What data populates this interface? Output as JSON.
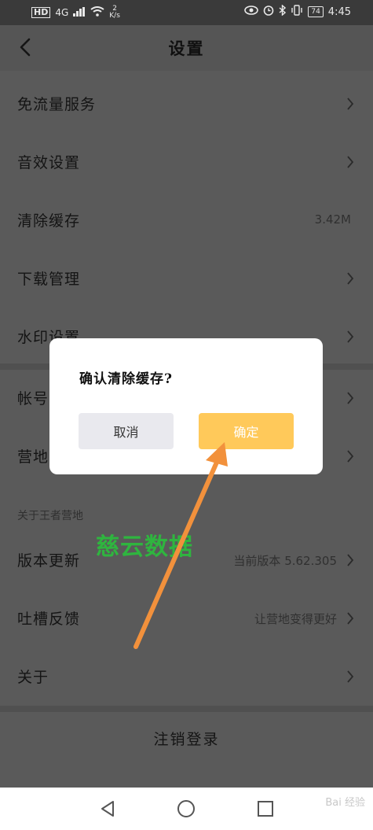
{
  "status_bar": {
    "hd": "HD",
    "network": "4G",
    "speed_value": "2",
    "speed_unit": "K/s",
    "battery": "74",
    "time": "4:45"
  },
  "nav": {
    "title": "设置"
  },
  "settings": {
    "items": [
      {
        "label": "免流量服务"
      },
      {
        "label": "音效设置"
      },
      {
        "label": "清除缓存",
        "value": "3.42M"
      },
      {
        "label": "下载管理"
      },
      {
        "label": "水印设置"
      },
      {
        "label": "帐号"
      },
      {
        "label": "营地"
      }
    ],
    "section_about": "关于王者营地",
    "about_items": [
      {
        "label": "版本更新",
        "value": "当前版本 5.62.305"
      },
      {
        "label": "吐槽反馈",
        "value": "让营地变得更好"
      },
      {
        "label": "关于"
      }
    ],
    "logout": "注销登录"
  },
  "watermark": "慈云数据",
  "dialog": {
    "title": "确认清除缓存?",
    "cancel": "取消",
    "confirm": "确定"
  },
  "system_nav": {
    "baidu": "Bai 经验"
  },
  "colors": {
    "dim_background": "#5a5a5a",
    "confirm_button": "#ffc95a",
    "cancel_button": "#e9e9ee",
    "annotation_arrow": "#f2913c",
    "watermark_green": "#2fb53f"
  }
}
